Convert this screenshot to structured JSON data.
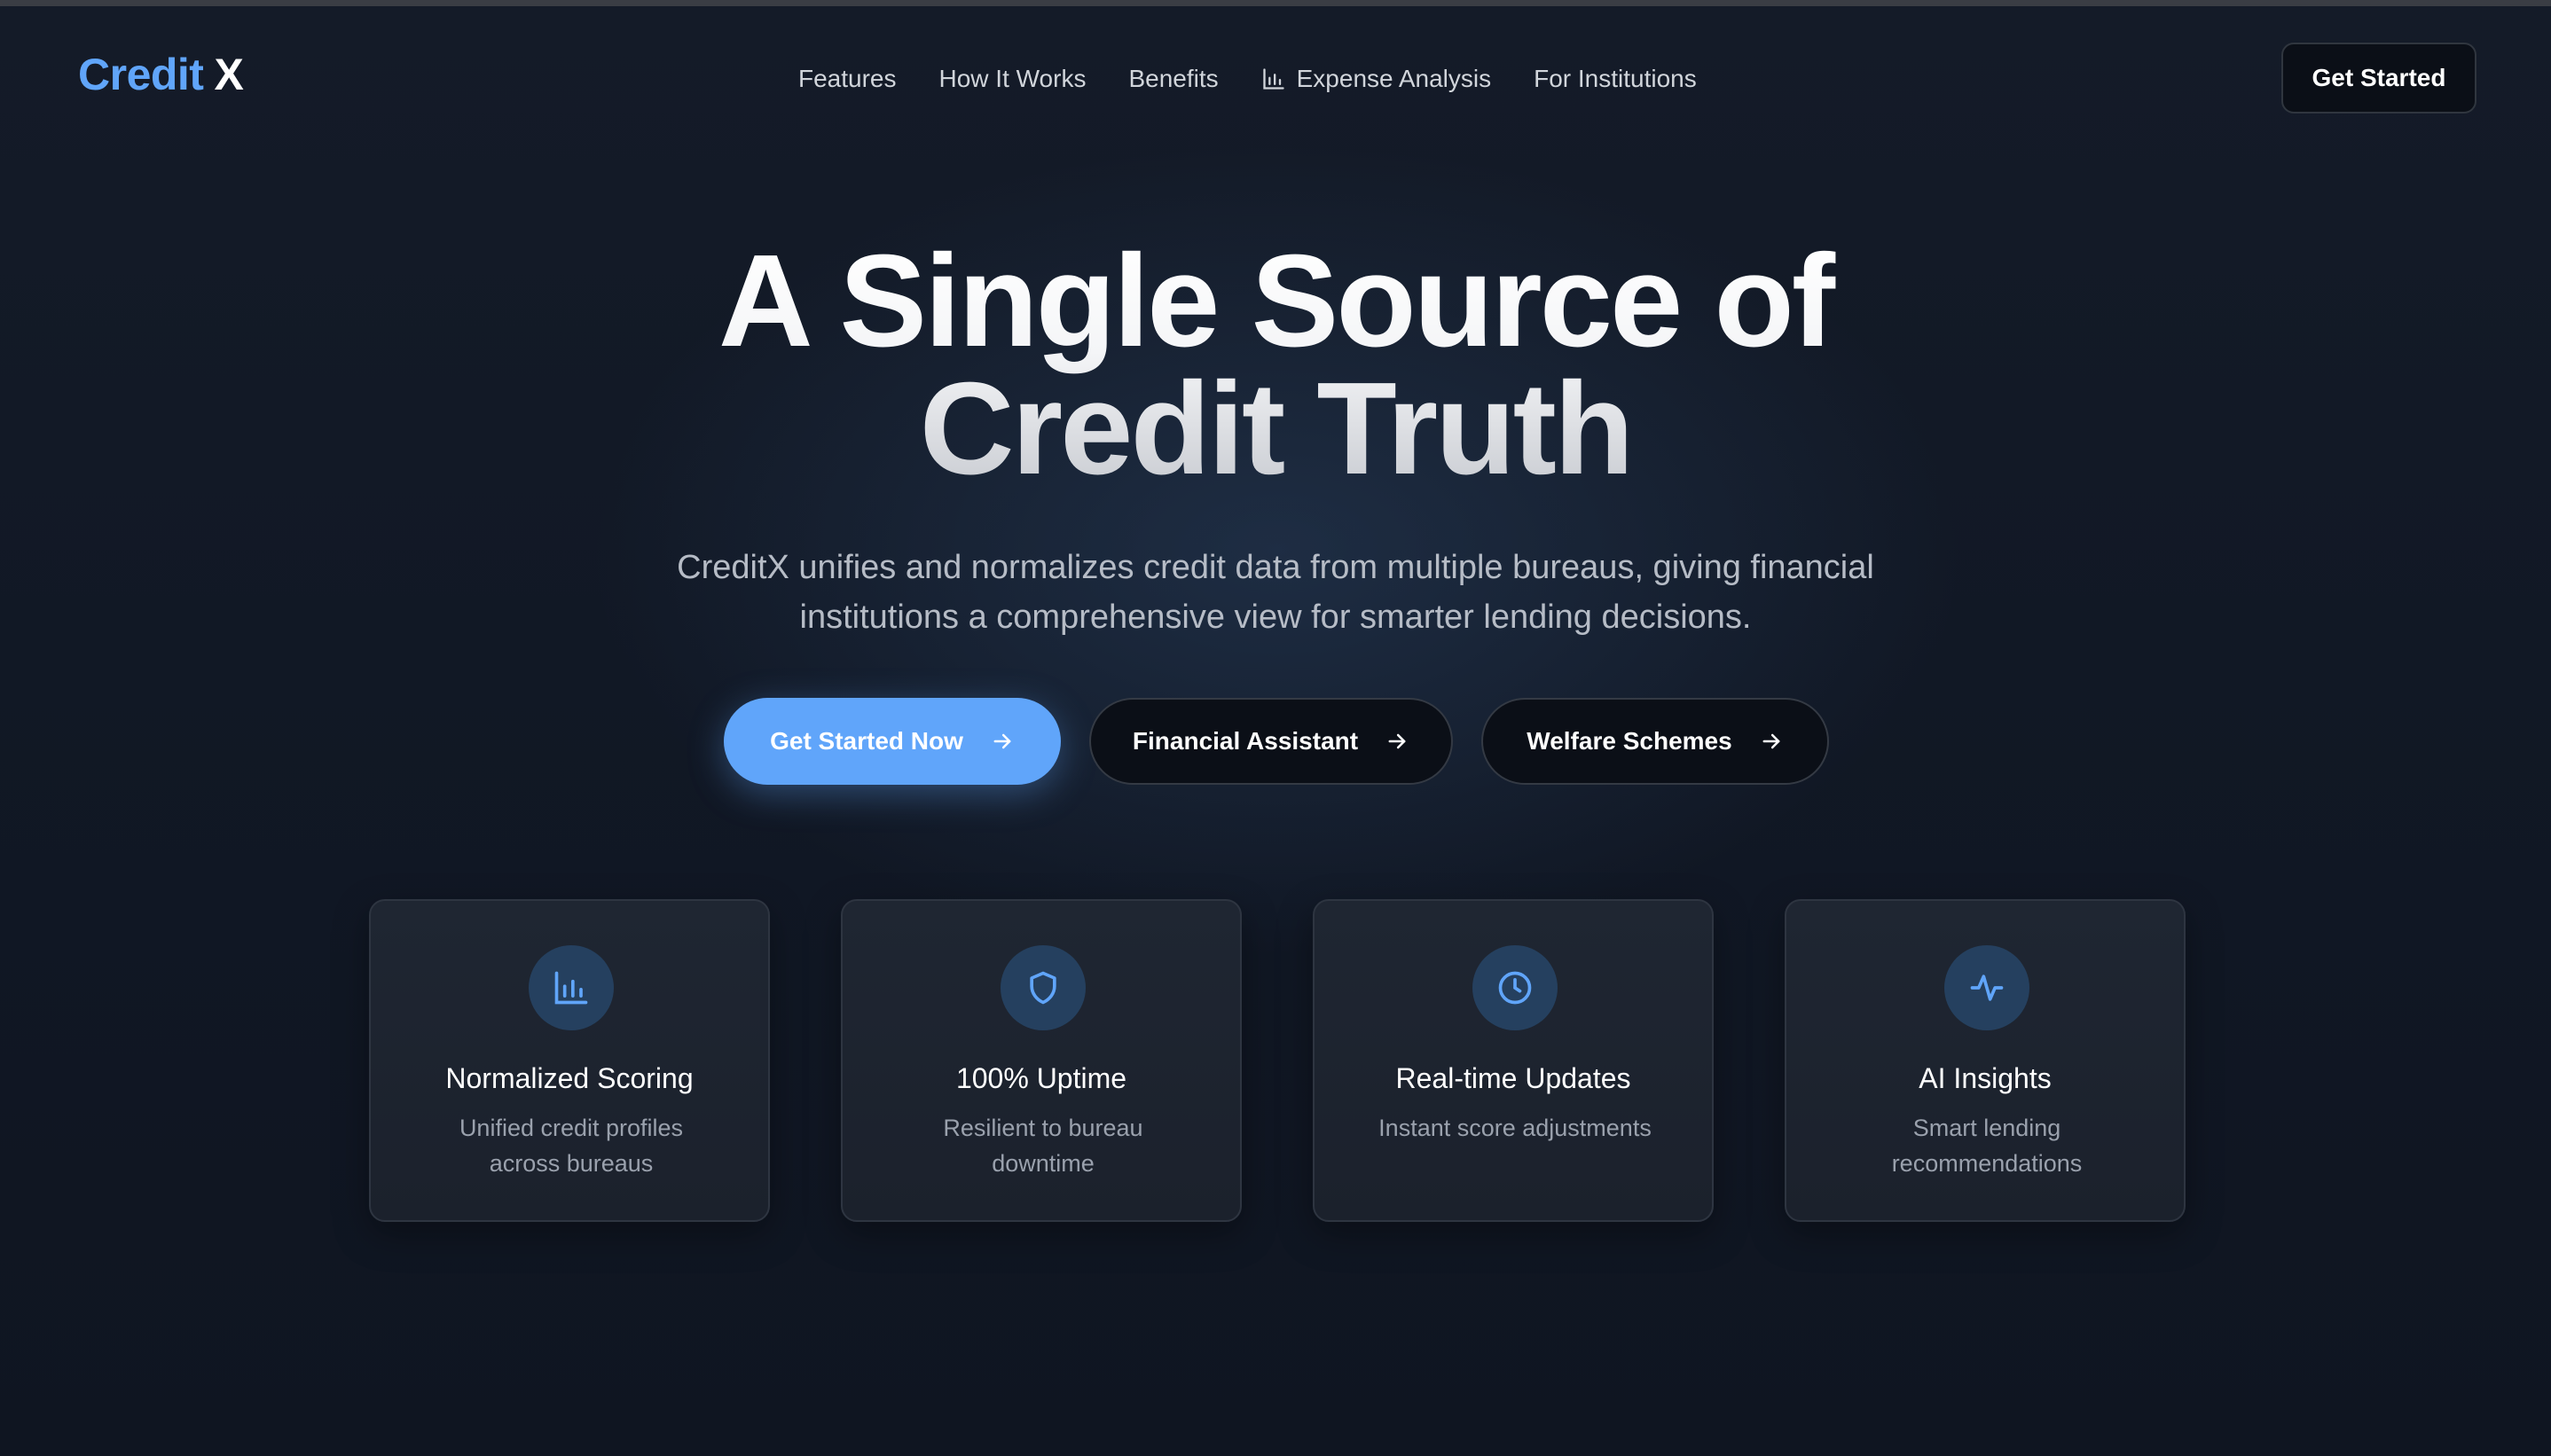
{
  "brand": {
    "name_part1": "Credit",
    "name_part2": "X",
    "accent": "#60a5fa"
  },
  "nav": {
    "links": [
      {
        "label": "Features",
        "icon": ""
      },
      {
        "label": "How It Works",
        "icon": ""
      },
      {
        "label": "Benefits",
        "icon": ""
      },
      {
        "label": "Expense Analysis",
        "icon": "bar-chart-icon"
      },
      {
        "label": "For Institutions",
        "icon": ""
      }
    ],
    "cta_label": "Get Started"
  },
  "hero": {
    "title_line1": "A Single Source of",
    "title_line2": "Credit Truth",
    "subtitle_line1": "CreditX unifies and normalizes credit data from multiple bureaus, giving financial",
    "subtitle_line2": "institutions a comprehensive view for smarter lending decisions."
  },
  "ctas": {
    "primary_label": "Get Started Now",
    "secondary_label": "Financial Assistant",
    "tertiary_label": "Welfare Schemes",
    "arrow_icon": "arrow-right-icon"
  },
  "features": [
    {
      "icon": "bar-chart-icon",
      "title": "Normalized Scoring",
      "desc_line1": "Unified credit profiles",
      "desc_line2": "across bureaus"
    },
    {
      "icon": "shield-icon",
      "title": "100% Uptime",
      "desc_line1": "Resilient to bureau",
      "desc_line2": "downtime"
    },
    {
      "icon": "clock-icon",
      "title": "Real-time Updates",
      "desc_line1": "Instant score adjustments",
      "desc_line2": ""
    },
    {
      "icon": "activity-icon",
      "title": "AI Insights",
      "desc_line1": "Smart lending",
      "desc_line2": "recommendations"
    }
  ]
}
